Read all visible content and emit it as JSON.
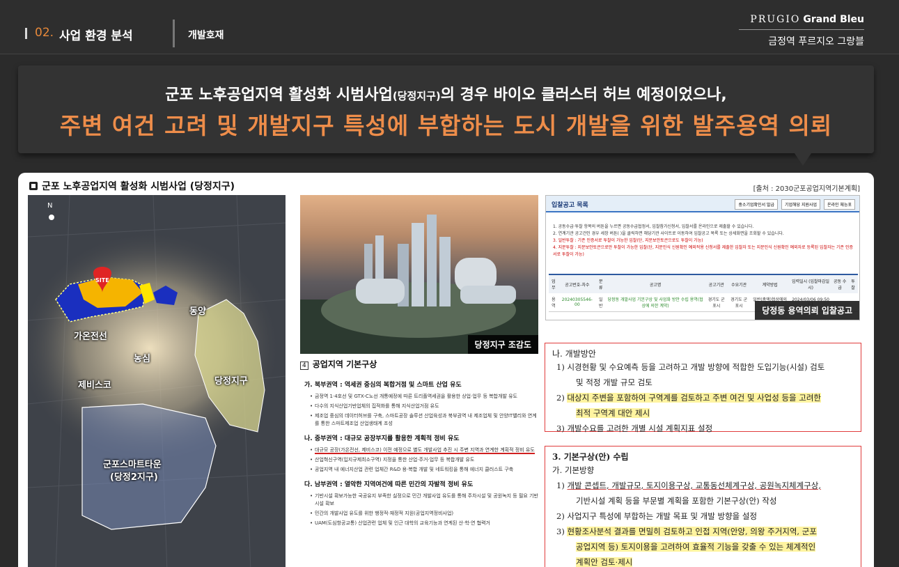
{
  "header": {
    "section_number": "02.",
    "section_title": "사업 환경 분석",
    "subsection": "개발호재",
    "brand_main": "PRUGIO",
    "brand_main_bold": "Grand Bleu",
    "brand_sub": "금정역 푸르지오 그랑블"
  },
  "banner": {
    "line1_a": "군포 노후공업지역 활성화 시범사업",
    "line1_small": "(당정지구)",
    "line1_b": "의 경우 바이오 클러스터 허브 예정이었으나,",
    "line2": "주변 여건 고려 및 개발지구 특성에 부합하는 도시 개발을 위한 발주용역 의뢰"
  },
  "section": {
    "title": "군포 노후공업지역 활성화 시범사업 (당정지구)",
    "source": "[출처 : 2030군포공업지역기본계획]"
  },
  "map": {
    "compass": "N",
    "site_label": "SITE",
    "labels": [
      "동양",
      "가온전선",
      "농심",
      "제비스코",
      "당정지구",
      "군포스마트타운",
      "(당정2지구)"
    ]
  },
  "render": {
    "caption": "당정지구 조감도"
  },
  "bid": {
    "title": "입찰공고 목록",
    "buttons": [
      "중소기업확인서 발급",
      "기업해당 지원사업",
      "온라인 체능포"
    ],
    "notes": [
      "1. 공동수급·투찰 항목의 버튼을 누르면 공동수급협정서, 입찰참가신청서, 입찰서를 온라인으로 제출할 수 있습니다.",
      "2. 연계기관 공고건인 경우 세창 버튼( )을 클릭하면 해당기관 사이트로 이동하여 입찰공고 목록 또는 상세화면을 조회할 수 있습니다.",
      "3. 일반투찰 : 기존 인증서로 투찰이 가능한 입찰(단, 지문보안토큰으로도 투찰이 가능)",
      "4. 지문투찰 : 지문보안토큰으로만 투찰이 가능한 입찰(단, 지문인식 신원확인 예외적용 신청서를 제출한 입찰자 또는 지문인식 신원확인 예외자로 등록된 입찰자는 기존 인증서로 투찰이 가능)"
    ],
    "table_headers": [
      "업무",
      "공고번호-차수",
      "분류",
      "공고명",
      "공고기관",
      "수요기관",
      "계약방법",
      "입력일시 (입찰마감일시)",
      "공동 수급",
      "투찰"
    ],
    "table_row": [
      "용역",
      "20240305546-00",
      "일반",
      "당정동 개발사업 기본구상 및 사업화 방안 수립 용역(협상에 의한 계약)",
      "경기도 군포시",
      "경기도 군포시",
      "일반(총액)협상에의한계약",
      "2024/03/06 09:50 (-)",
      "",
      ""
    ],
    "caption": "당정동 용역의뢰 입찰공고"
  },
  "doc": {
    "heading_box": "4",
    "heading": "공업지역 기본구상",
    "sections": [
      {
        "title": "가. 북부권역 : 역세권 중심의 복합거점 및 스마트 산업 유도",
        "items": [
          "금정역 1·4호선 및 GTX-C노선 개통예정에 따른 트리플역세권을 활용한 상업·업무 등 복합개발 유도",
          "다수의 지식산업기반업체의 집적화를 통해 지식산업거점 유도",
          "제조업 중심의 데이터허브를 구축, 스마트공장 솔루션 산업육성과 북부권역 내 제조업체 및 안양IT밸리와 연계를 통한 스마트제조업 산업생태계 조성"
        ]
      },
      {
        "title": "나. 중부권역 : 대규모 공장부지를 활용한 계획적 정비 유도",
        "items": [
          "대규모 공장(가온전선, 제비스코) 이전 예정으로 별도 개발사업 추진 시 주변 지역과 연계한 계획적 정비 유도",
          "산업혁신구역(입지규제최소구역) 지정을 통한 산업·주거·업무 등 복합개발 유도",
          "공업지역 내 에너지산업 관련 업체간 R&D 용·복합 개발 및 네트워킹을 통해 에너지 클러스트 구축"
        ]
      },
      {
        "title": "다. 남부권역 : 열악한 지역여건에 따른 민간의 자발적 정비 유도",
        "items": [
          "기반시설 확보가능한 국공유지 부족한 실정으로 민간 개발사업 유도를 통해 주차시설 및 공원녹지 등 필요 기반시설 확보",
          "민간의 개발사업 유도를 위한 행정적·재정적 지원(공업지역정비사업)",
          "UAM(도심항공교통) 산업관련 업체 및 인근 대학의 교육기능과 연계된 산·학·연 협력거"
        ]
      }
    ]
  },
  "box1": {
    "head": "나. 개발방안",
    "items": [
      {
        "num": "1)",
        "line1": "시경현황 및 수요예측 등을 고려하고 개발 방향에 적합한 도입기능(시설) 검토",
        "line2": "및 적정 개발 규모 검토"
      },
      {
        "num": "2)",
        "line1": "대상지 주변을 포함하여 구역계를 검토하고 주변 여건 및 사업성 등을 고려한",
        "line2": "최적 구역계 대안 제시"
      },
      {
        "num": "3)",
        "line1": "개발수요를 고려한 개별 시설 계획지표 설정",
        "line2": ""
      }
    ]
  },
  "box2": {
    "head": "3. 기본구상(안) 수립",
    "subhead": "가. 기본방향",
    "items": [
      {
        "num": "1)",
        "line1": "개발 콘셉트, 개발규모, 토지이용구상, 교통동선체계구상, 공원녹지체계구상,",
        "line2": "기반시설 계획 등을 부문별 계획을 포함한 기본구상(안) 작성"
      },
      {
        "num": "2)",
        "line1": "사업지구 특성에 부합하는 개발 목표 및 개발 방향을 설정",
        "line2": ""
      },
      {
        "num": "3)",
        "line1": "현황조사분석 결과를 면밀히 검토하고 인접 지역(안양, 의왕 주거지역, 군포",
        "line2": "공업지역 등) 토지이용을 고려하여 효율적 기능을 갖출 수 있는 체계적인",
        "line3": "계획안 검토·제시"
      }
    ]
  }
}
